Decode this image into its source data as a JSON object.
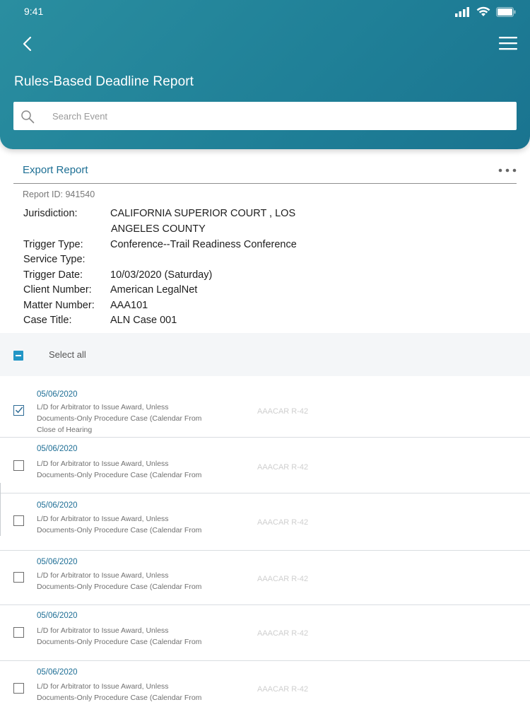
{
  "status": {
    "time": "9:41"
  },
  "header": {
    "title": "Rules-Based Deadline Report",
    "search_placeholder": "Search Event"
  },
  "toolbar": {
    "export_label": "Export Report"
  },
  "report": {
    "id_label": "Report ID:",
    "id_value": "941540",
    "fields": [
      {
        "label": "Jurisdiction:",
        "value_line1": "CALIFORNIA SUPERIOR COURT , LOS",
        "value_line2": "ANGELES COUNTY"
      },
      {
        "label": "Trigger Type:",
        "value": "Conference--Trail Readiness Conference"
      },
      {
        "label": "Service Type:",
        "value": ""
      },
      {
        "label": "Trigger Date:",
        "value": "10/03/2020 (Saturday)"
      },
      {
        "label": "Client Number:",
        "value": "American LegalNet"
      },
      {
        "label": "Matter Number:",
        "value": "AAA101"
      },
      {
        "label": "Case Title:",
        "value": "ALN Case 001"
      }
    ]
  },
  "selection": {
    "select_all_label": "Select all",
    "state": "indeterminate"
  },
  "rows": [
    {
      "checked": true,
      "date": "05/06/2020",
      "desc_line1": "L/D for Arbitrator to Issue Award, Unless",
      "desc_line2": "Documents-Only Procedure Case (Calendar From",
      "desc_line3": "Close of Hearing",
      "rule": "AAACAR R-42"
    },
    {
      "checked": false,
      "date": "05/06/2020",
      "desc_line1": "L/D for Arbitrator to Issue Award, Unless",
      "desc_line2": "Documents-Only Procedure Case (Calendar From",
      "rule": "AAACAR R-42"
    },
    {
      "checked": false,
      "date": "05/06/2020",
      "desc_line1": "L/D for Arbitrator to Issue Award, Unless",
      "desc_line2": "Documents-Only Procedure Case (Calendar From",
      "rule": "AAACAR R-42"
    },
    {
      "checked": false,
      "date": "05/06/2020",
      "desc_line1": "L/D for Arbitrator to Issue Award, Unless",
      "desc_line2": "Documents-Only Procedure Case (Calendar From",
      "rule": "AAACAR R-42"
    },
    {
      "checked": false,
      "date": "05/06/2020",
      "desc_line1": "L/D for Arbitrator to Issue Award, Unless",
      "desc_line2": "Documents-Only Procedure Case (Calendar From",
      "rule": "AAACAR R-42"
    },
    {
      "checked": false,
      "date": "05/06/2020",
      "desc_line1": "L/D for Arbitrator to Issue Award, Unless",
      "desc_line2": "Documents-Only Procedure Case (Calendar From",
      "rule": "AAACAR R-42"
    }
  ],
  "icons": {
    "back": "chevron-left-icon",
    "menu": "hamburger-menu-icon",
    "search": "search-icon",
    "more": "more-horizontal-icon",
    "check": "check-icon"
  },
  "colors": {
    "header": "#1f7f97",
    "accent_text": "#1d6f94",
    "checkbox_blue": "#2296c6"
  }
}
